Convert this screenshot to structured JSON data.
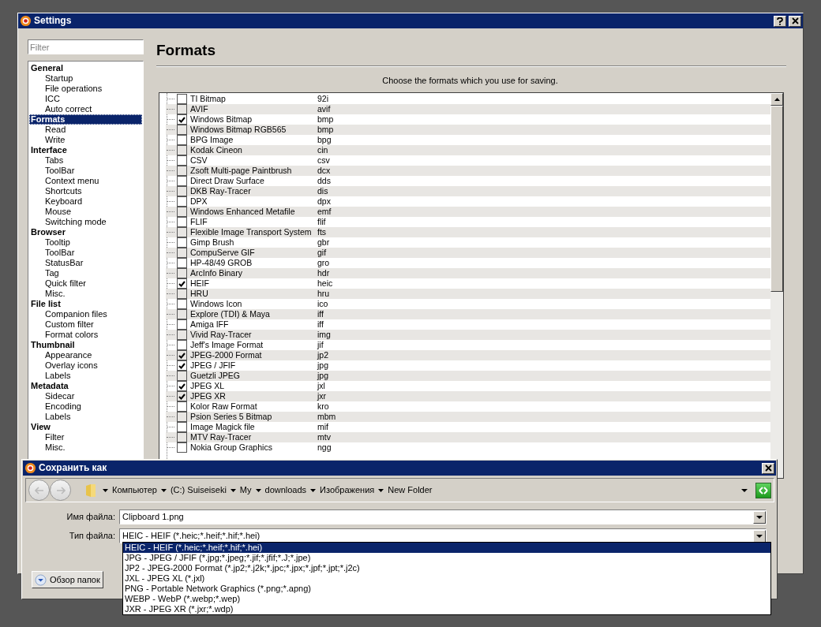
{
  "settings_window": {
    "title": "Settings",
    "sidebar": {
      "filter": {
        "placeholder": "Filter"
      },
      "groups": [
        {
          "label": "General",
          "selected": false,
          "children": [
            {
              "label": "Startup",
              "selected": false
            },
            {
              "label": "File operations",
              "selected": false
            },
            {
              "label": "ICC",
              "selected": false
            },
            {
              "label": "Auto correct",
              "selected": false
            }
          ]
        },
        {
          "label": "Formats",
          "selected": true,
          "children": [
            {
              "label": "Read",
              "selected": false
            },
            {
              "label": "Write",
              "selected": false
            }
          ]
        },
        {
          "label": "Interface",
          "selected": false,
          "children": [
            {
              "label": "Tabs",
              "selected": false
            },
            {
              "label": "ToolBar",
              "selected": false
            },
            {
              "label": "Context menu",
              "selected": false
            },
            {
              "label": "Shortcuts",
              "selected": false
            },
            {
              "label": "Keyboard",
              "selected": false
            },
            {
              "label": "Mouse",
              "selected": false
            },
            {
              "label": "Switching mode",
              "selected": false
            }
          ]
        },
        {
          "label": "Browser",
          "selected": false,
          "children": [
            {
              "label": "Tooltip",
              "selected": false
            },
            {
              "label": "ToolBar",
              "selected": false
            },
            {
              "label": "StatusBar",
              "selected": false
            },
            {
              "label": "Tag",
              "selected": false
            },
            {
              "label": "Quick filter",
              "selected": false
            },
            {
              "label": "Misc.",
              "selected": false
            }
          ]
        },
        {
          "label": "File list",
          "selected": false,
          "children": [
            {
              "label": "Companion files",
              "selected": false
            },
            {
              "label": "Custom filter",
              "selected": false
            },
            {
              "label": "Format colors",
              "selected": false
            }
          ]
        },
        {
          "label": "Thumbnail",
          "selected": false,
          "children": [
            {
              "label": "Appearance",
              "selected": false
            },
            {
              "label": "Overlay icons",
              "selected": false
            },
            {
              "label": "Labels",
              "selected": false
            }
          ]
        },
        {
          "label": "Metadata",
          "selected": false,
          "children": [
            {
              "label": "Sidecar",
              "selected": false
            },
            {
              "label": "Encoding",
              "selected": false
            },
            {
              "label": "Labels",
              "selected": false
            }
          ]
        },
        {
          "label": "View",
          "selected": false,
          "children": [
            {
              "label": "Filter",
              "selected": false
            },
            {
              "label": "Misc.",
              "selected": false
            }
          ]
        }
      ]
    },
    "page": {
      "title": "Formats",
      "hint": "Choose the formats which you use for saving.",
      "formats": [
        {
          "name": "TI Bitmap",
          "ext": "92i",
          "checked": false
        },
        {
          "name": "AVIF",
          "ext": "avif",
          "checked": false
        },
        {
          "name": "Windows Bitmap",
          "ext": "bmp",
          "checked": true
        },
        {
          "name": "Windows Bitmap RGB565",
          "ext": "bmp",
          "checked": false
        },
        {
          "name": "BPG Image",
          "ext": "bpg",
          "checked": false
        },
        {
          "name": "Kodak Cineon",
          "ext": "cin",
          "checked": false
        },
        {
          "name": "CSV",
          "ext": "csv",
          "checked": false
        },
        {
          "name": "Zsoft Multi-page Paintbrush",
          "ext": "dcx",
          "checked": false
        },
        {
          "name": "Direct Draw Surface",
          "ext": "dds",
          "checked": false
        },
        {
          "name": "DKB Ray-Tracer",
          "ext": "dis",
          "checked": false
        },
        {
          "name": "DPX",
          "ext": "dpx",
          "checked": false
        },
        {
          "name": "Windows Enhanced Metafile",
          "ext": "emf",
          "checked": false
        },
        {
          "name": "FLIF",
          "ext": "flif",
          "checked": false
        },
        {
          "name": "Flexible Image Transport System",
          "ext": "fts",
          "checked": false
        },
        {
          "name": "Gimp Brush",
          "ext": "gbr",
          "checked": false
        },
        {
          "name": "CompuServe GIF",
          "ext": "gif",
          "checked": false
        },
        {
          "name": "HP-48/49 GROB",
          "ext": "gro",
          "checked": false
        },
        {
          "name": "ArcInfo Binary",
          "ext": "hdr",
          "checked": false
        },
        {
          "name": "HEIF",
          "ext": "heic",
          "checked": true
        },
        {
          "name": "HRU",
          "ext": "hru",
          "checked": false
        },
        {
          "name": "Windows Icon",
          "ext": "ico",
          "checked": false
        },
        {
          "name": "Explore (TDI) & Maya",
          "ext": "iff",
          "checked": false
        },
        {
          "name": "Amiga IFF",
          "ext": "iff",
          "checked": false
        },
        {
          "name": "Vivid Ray-Tracer",
          "ext": "img",
          "checked": false
        },
        {
          "name": "Jeff's Image Format",
          "ext": "jif",
          "checked": false
        },
        {
          "name": "JPEG-2000 Format",
          "ext": "jp2",
          "checked": true
        },
        {
          "name": "JPEG / JFIF",
          "ext": "jpg",
          "checked": true
        },
        {
          "name": "Guetzli JPEG",
          "ext": "jpg",
          "checked": false
        },
        {
          "name": "JPEG XL",
          "ext": "jxl",
          "checked": true
        },
        {
          "name": "JPEG XR",
          "ext": "jxr",
          "checked": true
        },
        {
          "name": "Kolor Raw Format",
          "ext": "kro",
          "checked": false
        },
        {
          "name": "Psion Series 5 Bitmap",
          "ext": "mbm",
          "checked": false
        },
        {
          "name": "Image Magick file",
          "ext": "mif",
          "checked": false
        },
        {
          "name": "MTV Ray-Tracer",
          "ext": "mtv",
          "checked": false
        },
        {
          "name": "Nokia Group Graphics",
          "ext": "ngg",
          "checked": false
        }
      ]
    }
  },
  "save_dialog": {
    "title": "Сохранить как",
    "breadcrumbs": [
      "Компьютер",
      "(C:) Suiseiseki",
      "My",
      "downloads",
      "Изображения",
      "New Folder"
    ],
    "file_name": {
      "label": "Имя файла:",
      "value": "Clipboard 1.png"
    },
    "file_type": {
      "label": "Тип файла:",
      "value": "HEIC - HEIF (*.heic;*.heif;*.hif;*.hei)",
      "expanded": true,
      "options": [
        {
          "label": "HEIC - HEIF (*.heic;*.heif;*.hif;*.hei)",
          "selected": true
        },
        {
          "label": "JPG - JPEG / JFIF (*.jpg;*.jpeg;*.jif;*.jfif;*.J;*.jpe)",
          "selected": false
        },
        {
          "label": "JP2 - JPEG-2000 Format (*.jp2;*.j2k;*.jpc;*.jpx;*.jpf;*.jpt;*.j2c)",
          "selected": false
        },
        {
          "label": "JXL - JPEG XL (*.jxl)",
          "selected": false
        },
        {
          "label": "PNG - Portable Network Graphics (*.png;*.apng)",
          "selected": false
        },
        {
          "label": "WEBP - WebP (*.webp;*.wep)",
          "selected": false
        },
        {
          "label": "JXR - JPEG XR (*.jxr;*.wdp)",
          "selected": false
        }
      ]
    },
    "browse_button": "Обзор папок"
  }
}
